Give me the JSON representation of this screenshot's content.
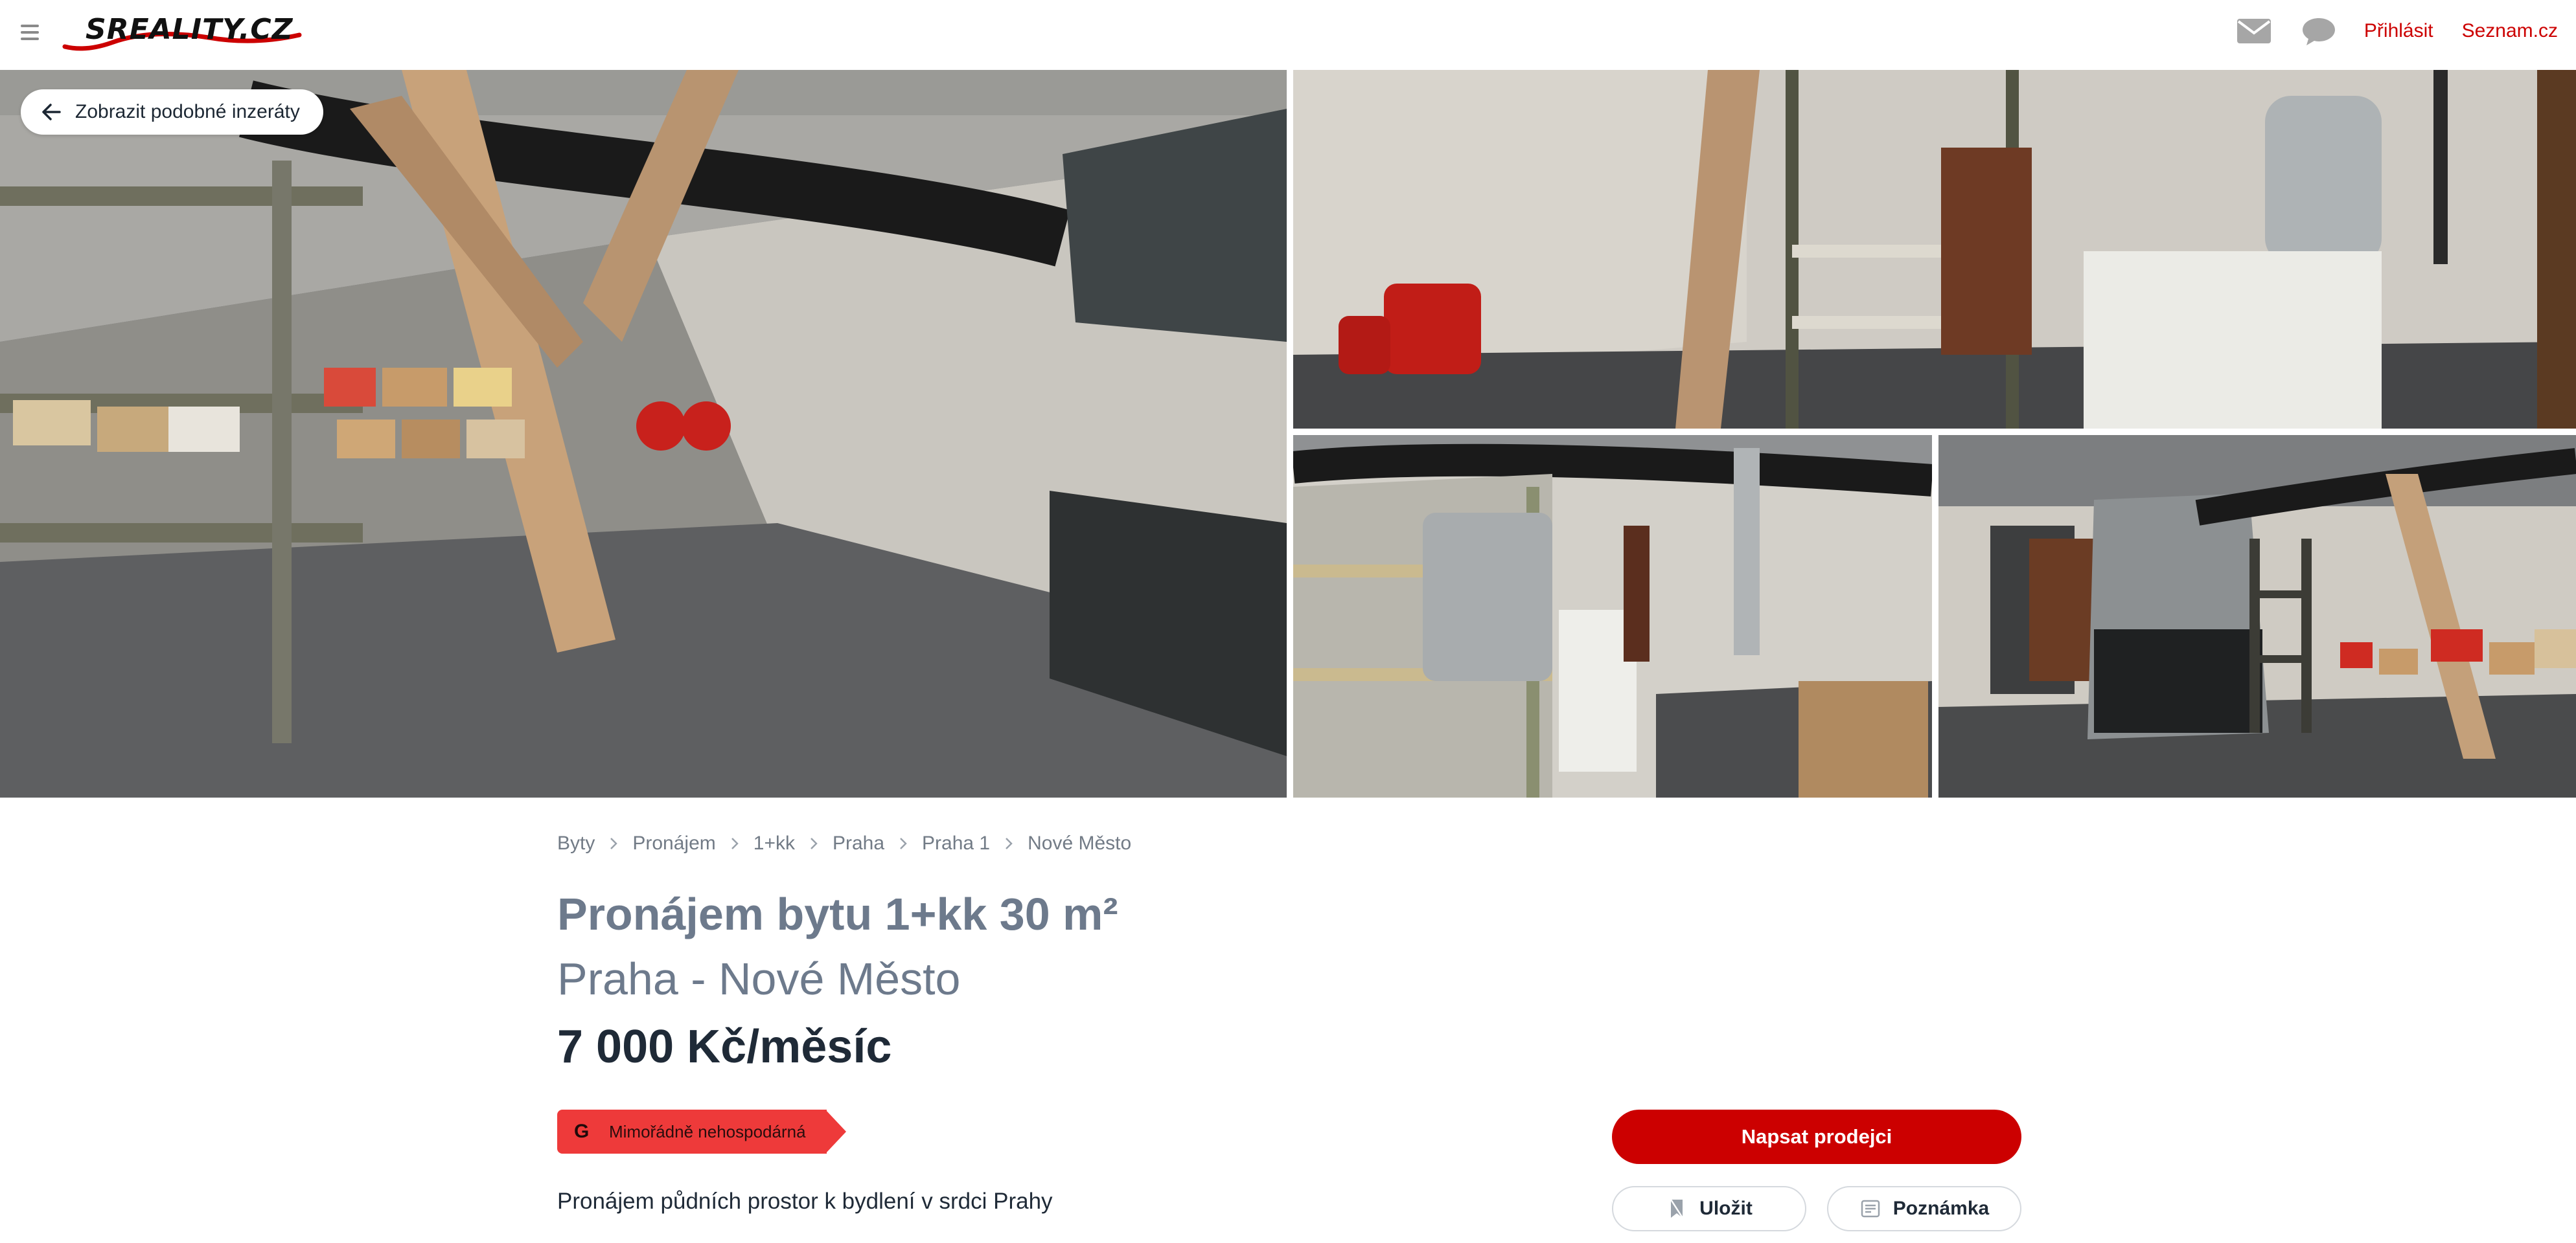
{
  "header": {
    "logo_text": "SREALITY.CZ",
    "login_label": "Přihlásit",
    "seznam_label": "Seznam.cz",
    "icons": [
      "menu-icon",
      "mail-icon",
      "chat-icon"
    ],
    "accent_color": "#cc0000"
  },
  "gallery": {
    "similar_button_label": "Zobrazit podobné inzeráty",
    "photo_count": 5
  },
  "breadcrumb": [
    "Byty",
    "Pronájem",
    "1+kk",
    "Praha",
    "Praha 1",
    "Nové Město"
  ],
  "listing": {
    "title_line1": "Pronájem bytu 1+kk 30 m²",
    "title_line2": "Praha - Nové Město",
    "price": "7 000 Kč/měsíc",
    "energy_class": "G",
    "energy_label": "Mimořádně nehospodárná",
    "energy_color": "#ee3a3a",
    "description": "Pronájem půdních prostor k bydlení v srdci Prahy"
  },
  "actions": {
    "contact_label": "Napsat prodejci",
    "save_label": "Uložit",
    "note_label": "Poznámka"
  }
}
